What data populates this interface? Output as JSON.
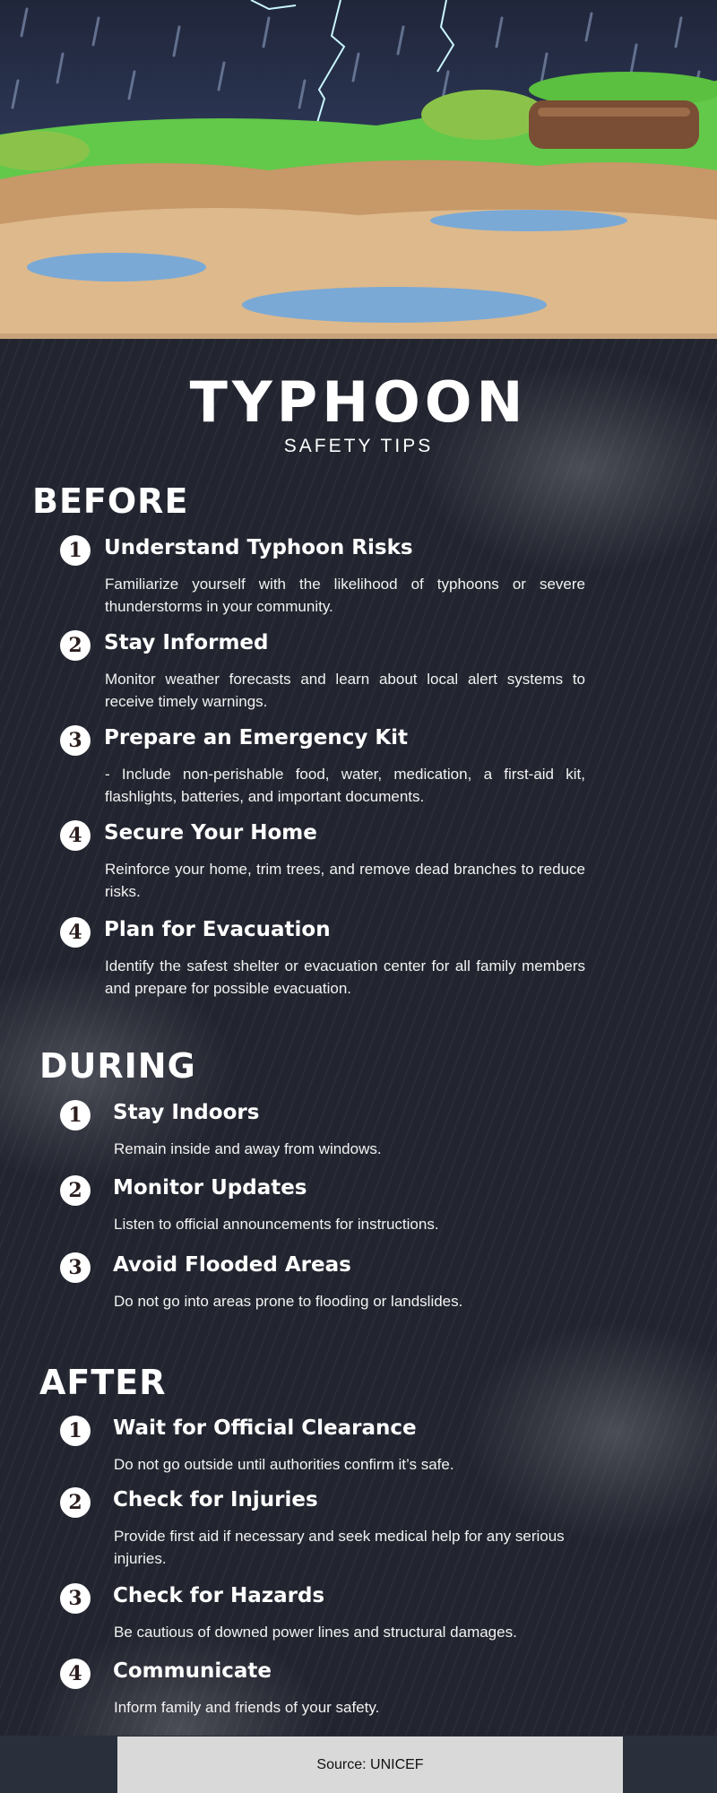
{
  "title": "TYPHOON",
  "subtitle": "SAFETY TIPS",
  "sections": {
    "before": {
      "heading": "BEFORE",
      "items": [
        {
          "num": "1",
          "title": "Understand Typhoon Risks",
          "desc": "Familiarize yourself with the likelihood of typhoons or severe thunderstorms in your community."
        },
        {
          "num": "2",
          "title": "Stay Informed",
          "desc": "Monitor weather forecasts and learn about local alert systems to receive timely warnings."
        },
        {
          "num": "3",
          "title": "Prepare an Emergency Kit",
          "desc": "- Include non-perishable food, water, medication, a first-aid kit, flashlights, batteries, and important documents."
        },
        {
          "num": "4",
          "title": "Secure Your Home",
          "desc": "Reinforce your home, trim trees, and remove dead branches to reduce risks."
        },
        {
          "num": "4",
          "title": "Plan for Evacuation",
          "desc": "Identify the safest shelter or evacuation center for all family members and prepare for possible evacuation."
        }
      ]
    },
    "during": {
      "heading": "DURING",
      "items": [
        {
          "num": "1",
          "title": "Stay Indoors",
          "desc": "Remain inside and away from windows."
        },
        {
          "num": "2",
          "title": "Monitor Updates",
          "desc": "Listen to official announcements for instructions."
        },
        {
          "num": "3",
          "title": "Avoid Flooded Areas",
          "desc": "Do not go into areas prone to flooding or landslides."
        }
      ]
    },
    "after": {
      "heading": "AFTER",
      "items": [
        {
          "num": "1",
          "title": "Wait for Official Clearance",
          "desc": "Do not go outside until authorities confirm it’s safe."
        },
        {
          "num": "2",
          "title": "Check for Injuries",
          "desc": "Provide first aid if necessary and seek medical help for any serious injuries."
        },
        {
          "num": "3",
          "title": "Check for Hazards",
          "desc": "Be cautious of downed power lines and structural damages."
        },
        {
          "num": "4",
          "title": "Communicate",
          "desc": "Inform family and friends of your safety."
        }
      ]
    }
  },
  "footer": {
    "source": "Source: UNICEF"
  }
}
